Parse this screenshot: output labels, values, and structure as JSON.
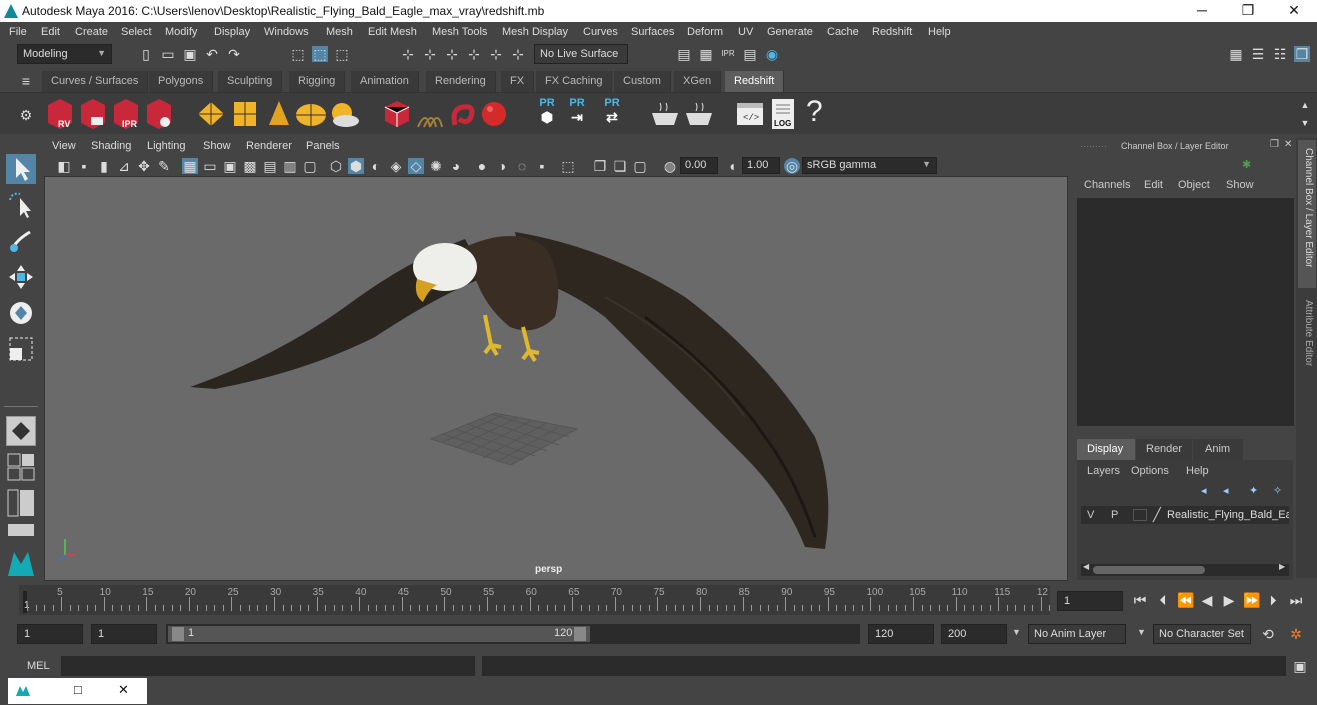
{
  "window": {
    "title": "Autodesk Maya 2016: C:\\Users\\lenov\\Desktop\\Realistic_Flying_Bald_Eagle_max_vray\\redshift.mb",
    "min": "─",
    "max": "❐",
    "close": "✕"
  },
  "menu": [
    "File",
    "Edit",
    "Create",
    "Select",
    "Modify",
    "Display",
    "Windows",
    "Mesh",
    "Edit Mesh",
    "Mesh Tools",
    "Mesh Display",
    "Curves",
    "Surfaces",
    "Deform",
    "UV",
    "Generate",
    "Cache",
    "Redshift",
    "Help"
  ],
  "status": {
    "mode": "Modeling",
    "live_surface": "No Live Surface"
  },
  "shelf_tabs": [
    "Curves / Surfaces",
    "Polygons",
    "Sculpting",
    "Rigging",
    "Animation",
    "Rendering",
    "FX",
    "FX Caching",
    "Custom",
    "XGen",
    "Redshift"
  ],
  "shelf_active": "Redshift",
  "shelf_icons": {
    "rv": "RV",
    "ipr": "IPR",
    "pr": "PR",
    "log": "LOG",
    "help": "?"
  },
  "view_menu": [
    "View",
    "Shading",
    "Lighting",
    "Show",
    "Renderer",
    "Panels"
  ],
  "view_bar": {
    "exposure": "0.00",
    "gamma": "1.00",
    "colorspace": "sRGB gamma"
  },
  "viewport": {
    "camera": "persp"
  },
  "channel_box": {
    "title": "Channel Box / Layer Editor",
    "menu": [
      "Channels",
      "Edit",
      "Object",
      "Show"
    ]
  },
  "side_tabs": [
    "Channel Box / Layer Editor",
    "Attribute Editor"
  ],
  "layer_editor": {
    "tabs": [
      "Display",
      "Render",
      "Anim"
    ],
    "active": "Display",
    "menu": [
      "Layers",
      "Options",
      "Help"
    ],
    "layer": {
      "v": "V",
      "p": "P",
      "name": "Realistic_Flying_Bald_Eag"
    }
  },
  "timeline": {
    "ticks": [
      "5",
      "10",
      "15",
      "20",
      "25",
      "30",
      "35",
      "40",
      "45",
      "50",
      "55",
      "60",
      "65",
      "70",
      "75",
      "80",
      "85",
      "90",
      "95",
      "100",
      "105",
      "110",
      "115",
      "12"
    ],
    "start_marker": "1",
    "current_frame": "1"
  },
  "range": {
    "start": "1",
    "inner_start": "1",
    "slider_start": "1",
    "slider_end": "120",
    "end": "120",
    "max_end": "200",
    "anim_layer": "No Anim Layer",
    "char_set": "No Character Set"
  },
  "cmd": {
    "label": "MEL"
  },
  "colors": {
    "accent": "#5d5d5d",
    "redshift": "#c8283a",
    "selected": "#5285a6"
  }
}
